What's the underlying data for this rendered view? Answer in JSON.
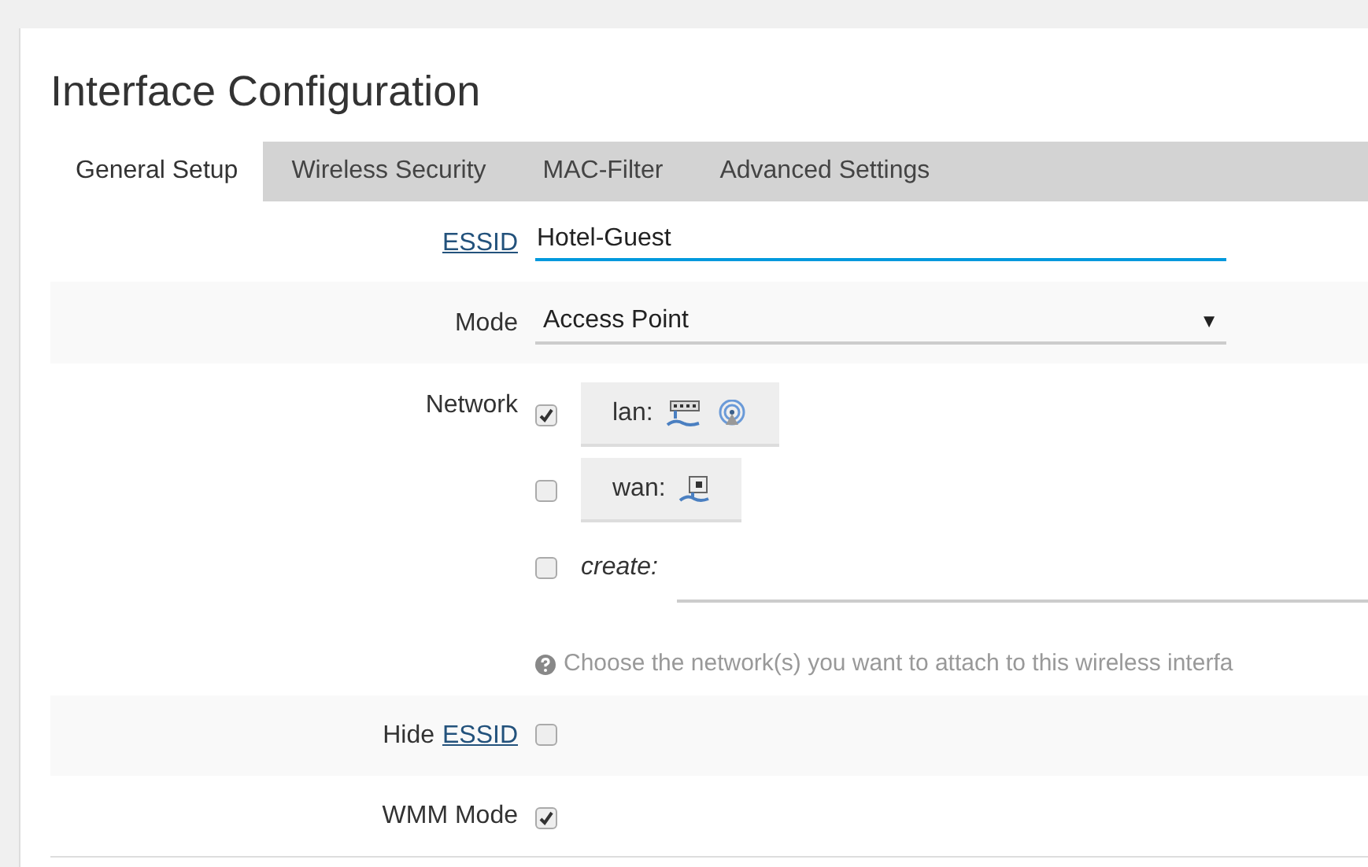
{
  "title": "Interface Configuration",
  "tabs": [
    {
      "label": "General Setup",
      "selected": true
    },
    {
      "label": "Wireless Security",
      "selected": false
    },
    {
      "label": "MAC-Filter",
      "selected": false
    },
    {
      "label": "Advanced Settings",
      "selected": false
    }
  ],
  "fields": [
    {
      "kind": "text",
      "link": "ESSID",
      "value": "Hotel-Guest"
    },
    {
      "kind": "select",
      "label": "Mode",
      "value": "Access Point",
      "arrow": "▼"
    },
    {
      "kind": "network",
      "label": "Network",
      "options": [
        {
          "kind": "interface",
          "name": "lan:",
          "checked": true,
          "icons": [
            {
              "kind": "switch"
            },
            {
              "kind": "wireless"
            }
          ]
        },
        {
          "kind": "interface",
          "name": "wan:",
          "checked": false,
          "icons": [
            {
              "kind": "ethernet"
            }
          ]
        },
        {
          "kind": "create",
          "name": "create:",
          "checked": false
        }
      ],
      "help": "Choose the network(s) you want to attach to this wireless interfa"
    },
    {
      "kind": "checkbox",
      "label": "Hide",
      "link": "ESSID",
      "checked": false
    },
    {
      "kind": "checkbox",
      "label": "WMM Mode",
      "checked": true
    }
  ]
}
